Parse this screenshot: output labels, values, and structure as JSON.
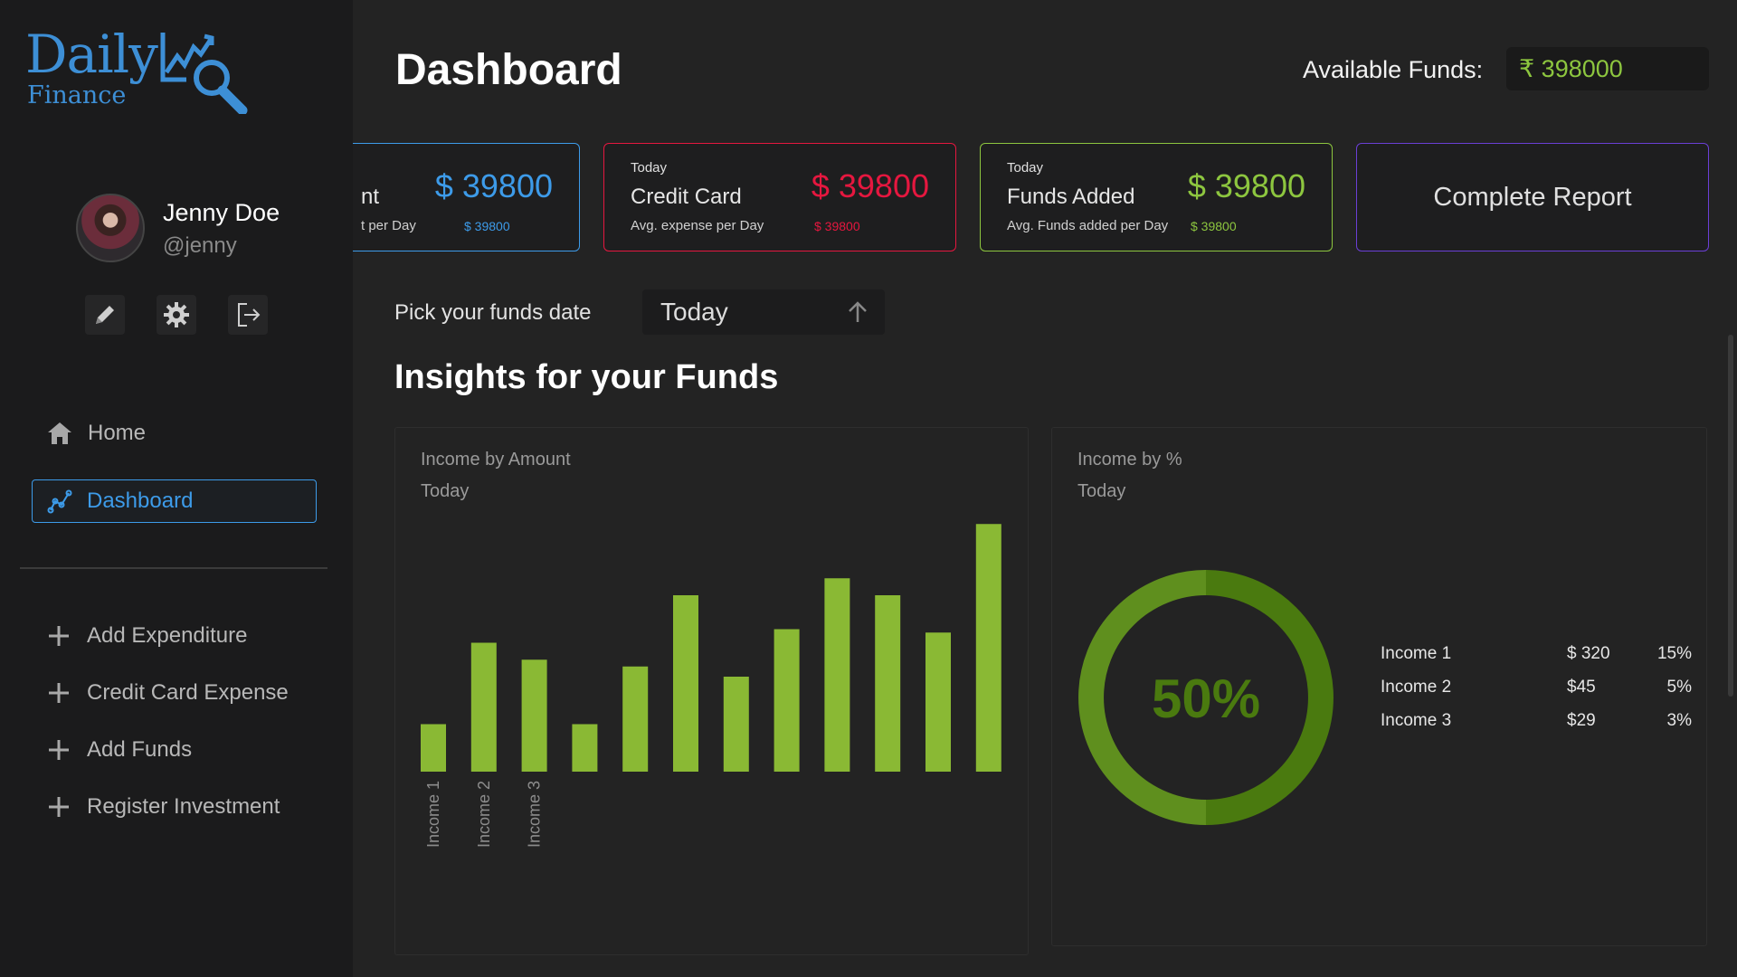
{
  "logo": {
    "line1": "Daily",
    "line2": "Finance"
  },
  "user": {
    "name": "Jenny Doe",
    "handle": "@jenny"
  },
  "sidebar": {
    "nav": [
      {
        "label": "Home",
        "icon": "home-icon"
      },
      {
        "label": "Dashboard",
        "icon": "chart-line-icon"
      }
    ],
    "actions": [
      {
        "label": "Add Expenditure"
      },
      {
        "label": "Credit Card Expense"
      },
      {
        "label": "Add Funds"
      },
      {
        "label": "Register Investment"
      }
    ]
  },
  "header": {
    "title": "Dashboard",
    "funds_label": "Available Funds:",
    "funds_value": "₹ 398000"
  },
  "cards": [
    {
      "title": "nt",
      "sub": "t per Day",
      "big": "$ 39800",
      "small": "$ 39800",
      "color": "#3d9be9"
    },
    {
      "today": "Today",
      "title": "Credit Card",
      "sub": "Avg. expense per Day",
      "big": "$ 39800",
      "small": "$ 39800",
      "color": "#e5173f"
    },
    {
      "today": "Today",
      "title": "Funds Added",
      "sub": "Avg. Funds added per Day",
      "big": "$ 39800",
      "small": "$ 39800",
      "color": "#8dc63f"
    },
    {
      "title": "Complete Report",
      "color": "#6b3fd6"
    }
  ],
  "picker": {
    "label": "Pick your funds date",
    "value": "Today"
  },
  "insights_title": "Insights for your Funds",
  "chart_data": [
    {
      "type": "bar",
      "title": "Income by Amount",
      "subtitle": "Today",
      "categories": [
        "Income 1",
        "Income 2",
        "Income 3",
        "",
        "",
        "",
        "",
        "",
        "",
        "",
        "",
        ""
      ],
      "values": [
        14,
        38,
        33,
        14,
        31,
        52,
        28,
        42,
        57,
        52,
        41,
        73
      ],
      "ylim": [
        0,
        80
      ],
      "color": "#8ab934"
    },
    {
      "type": "pie",
      "title": "Income by %",
      "subtitle": "Today",
      "center_label": "50%",
      "values": [
        50,
        50
      ],
      "colors": [
        "#4a7a0f",
        "#5f8f1e"
      ],
      "rows": [
        {
          "name": "Income 1",
          "amount": "$ 320",
          "pct": "15%"
        },
        {
          "name": "Income 2",
          "amount": "$45",
          "pct": "5%"
        },
        {
          "name": "Income 3",
          "amount": "$29",
          "pct": "3%"
        }
      ]
    }
  ]
}
